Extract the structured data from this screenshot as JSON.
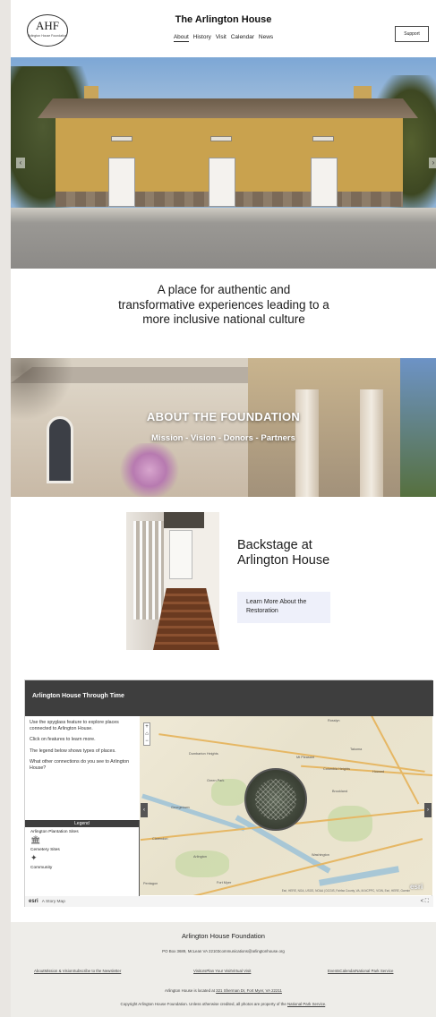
{
  "header": {
    "logo_text": "AHF",
    "logo_subtext": "Arlington House Foundation",
    "site_title": "The Arlington House",
    "nav": [
      "About",
      "History",
      "Visit",
      "Calendar",
      "News"
    ],
    "support_label": "Support"
  },
  "hero": {
    "prev_glyph": "‹",
    "next_glyph": "›"
  },
  "mission": {
    "text": "A place for authentic and transformative experiences leading to a more inclusive national culture"
  },
  "about": {
    "title": "ABOUT THE FOUNDATION",
    "subtitle": "Mission - Vision - Donors - Partners"
  },
  "backstage": {
    "title": "Backstage at Arlington House",
    "button_label": "Learn More About the Restoration"
  },
  "story_map": {
    "title": "Arlington House Through Time",
    "instructions": [
      "Use the spyglass feature to explore places connected to Arlington House.",
      "Click on features to learn more.",
      "The legend below shows types of places.",
      "What other connections do you see to Arlington House?"
    ],
    "legend_title": "Legend",
    "legend_items": [
      "Arlington Plantation Sites",
      "Cemetery Sites",
      "Community"
    ],
    "zoom_in": "+",
    "home": "⌂",
    "zoom_out": "−",
    "arrow_left": "‹",
    "arrow_right": "›",
    "map_labels": [
      "Rosslyn",
      "Arlington",
      "Washington",
      "Georgetown",
      "Pentagon",
      "Green Park",
      "Mt Pleasant",
      "Columbia Heights",
      "Takoma",
      "Brookland",
      "Dumbarton Heights",
      "Clarendon",
      "Howard",
      "Fort Myer"
    ],
    "attribution": "Esri, HERE, NGA, USGS, NOAA | DCGIS, Fairfax County, VA, M-NCPPC, VGIN, Esri, HERE, Garmin",
    "esri_logo": "esri",
    "footer_brand": "esri",
    "footer_text": "A Story Map",
    "footer_controls": "< ⛶"
  },
  "footer": {
    "title": "Arlington House Foundation",
    "address": "PO Box 3689, McLean VA 22103communications@arlingtonhouse.org",
    "links": [
      "AboutMission & VisionSubscribe to the Newsletter",
      "VisitorsPlan Your VisitVirtual Visit",
      "EventsCalendarNational Park Service"
    ],
    "located_prefix": "Arlington House is located at ",
    "located_address": "321 Sherman Dr, Fort Myer, VA 22211",
    "copyright_prefix": "Copyright Arlington House Foundation. Unless otherwise credited, all photos are property of the ",
    "copyright_link": "National Park Service",
    "copyright_suffix": "."
  },
  "colors": {
    "map_header": "#3e3e3e",
    "button_bg": "#eef0fa",
    "footer_bg": "#eeede9",
    "page_bg": "#e9e6e2"
  }
}
